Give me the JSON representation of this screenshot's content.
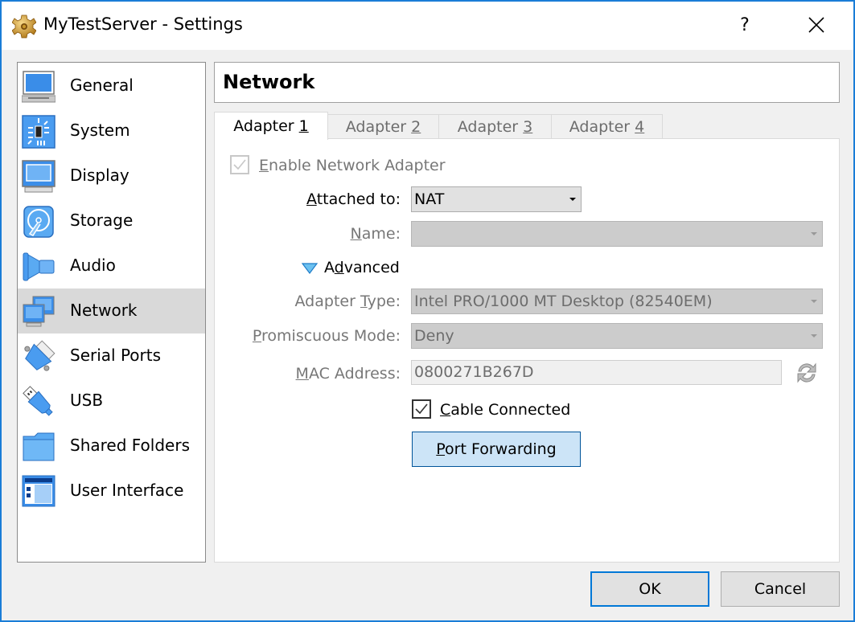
{
  "window": {
    "title": "MyTestServer - Settings",
    "help_label": "?",
    "title_icon": "gear-icon",
    "accent_color": "#1a7dd7"
  },
  "sidebar": {
    "items": [
      {
        "label": "General",
        "icon": "general-monitor-icon",
        "selected": false
      },
      {
        "label": "System",
        "icon": "system-chip-icon",
        "selected": false
      },
      {
        "label": "Display",
        "icon": "display-monitor-icon",
        "selected": false
      },
      {
        "label": "Storage",
        "icon": "storage-disk-icon",
        "selected": false
      },
      {
        "label": "Audio",
        "icon": "audio-speaker-icon",
        "selected": false
      },
      {
        "label": "Network",
        "icon": "network-monitors-icon",
        "selected": true
      },
      {
        "label": "Serial Ports",
        "icon": "serial-port-icon",
        "selected": false
      },
      {
        "label": "USB",
        "icon": "usb-icon",
        "selected": false
      },
      {
        "label": "Shared Folders",
        "icon": "folder-icon",
        "selected": false
      },
      {
        "label": "User Interface",
        "icon": "user-interface-icon",
        "selected": false
      }
    ]
  },
  "header": {
    "title": "Network"
  },
  "tabs": [
    {
      "prefix": "Adapter ",
      "mnemonic": "1",
      "active": true
    },
    {
      "prefix": "Adapter ",
      "mnemonic": "2",
      "active": false
    },
    {
      "prefix": "Adapter ",
      "mnemonic": "3",
      "active": false
    },
    {
      "prefix": "Adapter ",
      "mnemonic": "4",
      "active": false
    }
  ],
  "adapter": {
    "enable": {
      "mnemonic": "E",
      "rest": "nable Network Adapter",
      "checked": true,
      "disabled": true
    },
    "attached_to": {
      "mnemonic": "A",
      "rest": "ttached to:",
      "value": "NAT"
    },
    "name": {
      "mnemonic": "N",
      "rest": "ame:",
      "value": ""
    },
    "advanced": {
      "pre": "A",
      "mnemonic": "d",
      "rest": "vanced",
      "expanded": true
    },
    "adapter_type": {
      "pre": "Adapter ",
      "mnemonic": "T",
      "rest": "ype:",
      "value": "Intel PRO/1000 MT Desktop (82540EM)"
    },
    "promiscuous_mode": {
      "mnemonic": "P",
      "rest": "romiscuous Mode:",
      "value": "Deny"
    },
    "mac_address": {
      "mnemonic": "M",
      "rest": "AC Address:",
      "value": "0800271B267D"
    },
    "cable_connected": {
      "mnemonic": "C",
      "rest": "able Connected",
      "checked": true
    },
    "port_forwarding": {
      "mnemonic": "P",
      "rest": "ort Forwarding"
    }
  },
  "footer": {
    "ok_label": "OK",
    "cancel_label": "Cancel"
  }
}
